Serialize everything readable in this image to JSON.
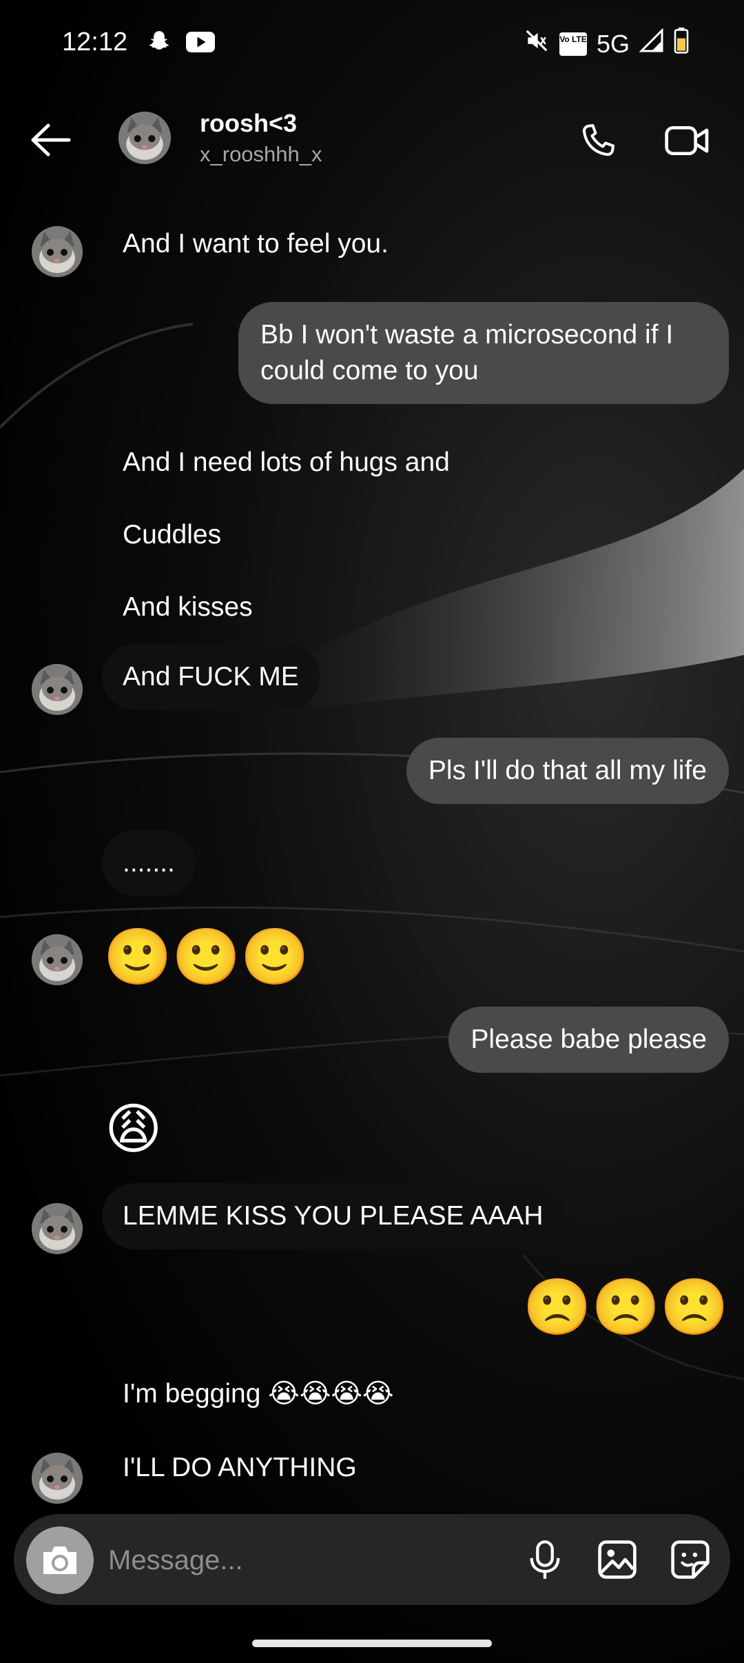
{
  "status_bar": {
    "time": "12:12",
    "network": "5G",
    "volte_badge": "Vo LTE"
  },
  "header": {
    "name": "roosh<3",
    "username": "x_rooshhh_x"
  },
  "messages": {
    "m1": "And I want to feel you.",
    "m2": "Bb I won't waste a microsecond if I could come to you",
    "m3": "And I need lots of hugs and",
    "m4": "Cuddles",
    "m5": "And kisses",
    "m6": "And FUCK ME",
    "m7": "Pls I'll do that all my life",
    "m8": ".......",
    "m9": "🙂🙂🙂",
    "m10": "Please babe please",
    "m11": "😩",
    "m12": "LEMME KISS YOU PLEASE AAAH",
    "m13": "🙁🙁🙁",
    "m14": "I'm begging 😭😭😭😭",
    "m15": "I'LL DO ANYTHING"
  },
  "composer": {
    "placeholder": "Message..."
  },
  "icons": {
    "back": "arrow-left",
    "call": "phone",
    "video": "video-camera",
    "camera": "camera",
    "mic": "microphone",
    "gallery": "image",
    "sticker": "sticker"
  },
  "colors": {
    "incoming_bubble": "#101010",
    "outgoing_bubble": "#4a4a4a",
    "composer_bg": "#262626"
  }
}
